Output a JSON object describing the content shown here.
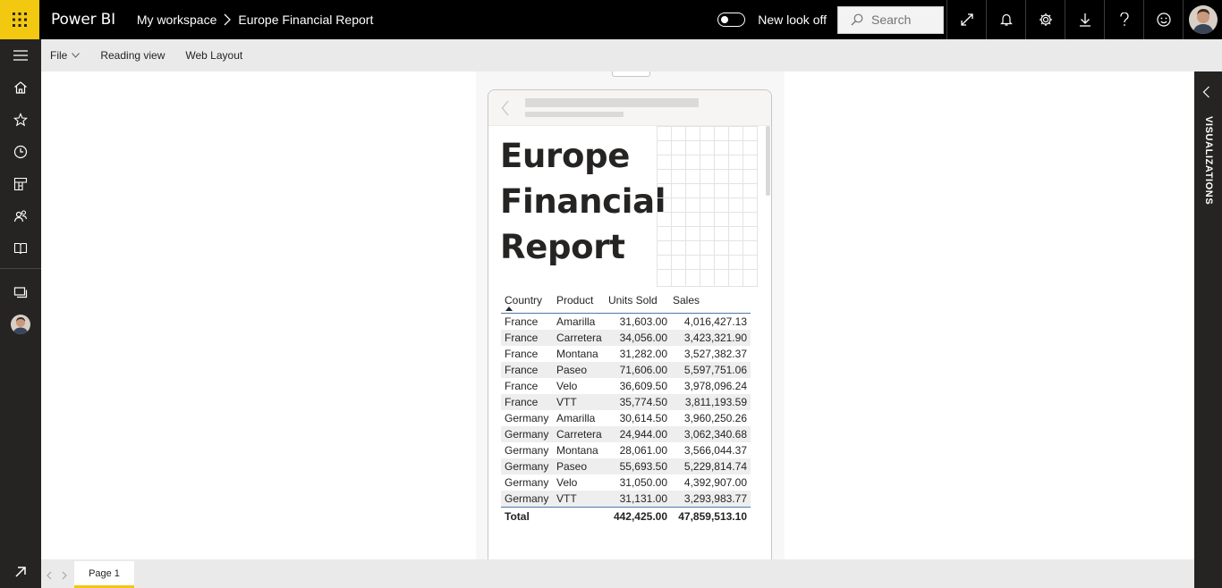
{
  "header": {
    "brand": "Power BI",
    "breadcrumb": [
      "My workspace",
      "Europe Financial Report"
    ],
    "toggle_label": "New look off",
    "search_placeholder": "Search",
    "accent_color": "#f2c811"
  },
  "toolbar": {
    "file_label": "File",
    "reading_view_label": "Reading view",
    "web_layout_label": "Web Layout"
  },
  "report": {
    "title_lines": [
      "Europe",
      "Financial",
      "Report"
    ],
    "table": {
      "columns": [
        "Country",
        "Product",
        "Units Sold",
        "Sales"
      ],
      "rows": [
        [
          "France",
          "Amarilla",
          "31,603.00",
          "4,016,427.13"
        ],
        [
          "France",
          "Carretera",
          "34,056.00",
          "3,423,321.90"
        ],
        [
          "France",
          "Montana",
          "31,282.00",
          "3,527,382.37"
        ],
        [
          "France",
          "Paseo",
          "71,606.00",
          "5,597,751.06"
        ],
        [
          "France",
          "Velo",
          "36,609.50",
          "3,978,096.24"
        ],
        [
          "France",
          "VTT",
          "35,774.50",
          "3,811,193.59"
        ],
        [
          "Germany",
          "Amarilla",
          "30,614.50",
          "3,960,250.26"
        ],
        [
          "Germany",
          "Carretera",
          "24,944.00",
          "3,062,340.68"
        ],
        [
          "Germany",
          "Montana",
          "28,061.00",
          "3,566,044.37"
        ],
        [
          "Germany",
          "Paseo",
          "55,693.50",
          "5,229,814.74"
        ],
        [
          "Germany",
          "Velo",
          "31,050.00",
          "4,392,907.00"
        ],
        [
          "Germany",
          "VTT",
          "31,131.00",
          "3,293,983.77"
        ]
      ],
      "total": {
        "label": "Total",
        "units": "442,425.00",
        "sales": "47,859,513.10"
      }
    }
  },
  "right_pane": {
    "label": "VISUALIZATIONS"
  },
  "footer": {
    "page_tab": "Page 1"
  }
}
